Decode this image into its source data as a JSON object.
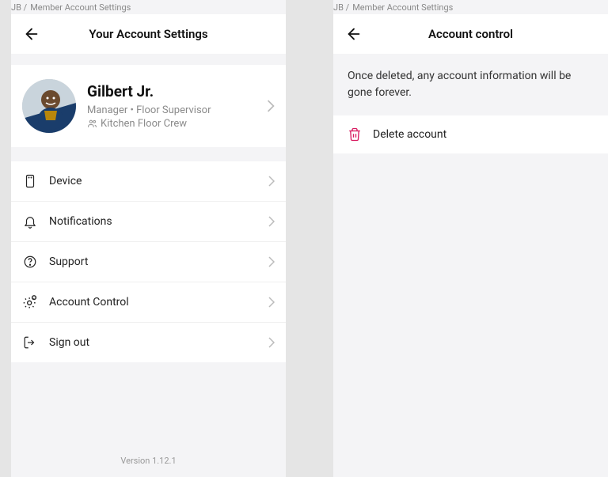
{
  "breadcrumb": {
    "prefix": "JB /",
    "page": "Member Account Settings"
  },
  "left": {
    "header_title": "Your Account Settings",
    "profile": {
      "name": "Gilbert Jr.",
      "role": "Manager • Floor Supervisor",
      "team": "Kitchen Floor Crew"
    },
    "menu": {
      "device": "Device",
      "notifications": "Notifications",
      "support": "Support",
      "account_control": "Account Control",
      "sign_out": "Sign out"
    },
    "version": "Version 1.12.1"
  },
  "right": {
    "header_title": "Account control",
    "info": "Once deleted, any account information will be gone forever.",
    "delete_label": "Delete account"
  }
}
